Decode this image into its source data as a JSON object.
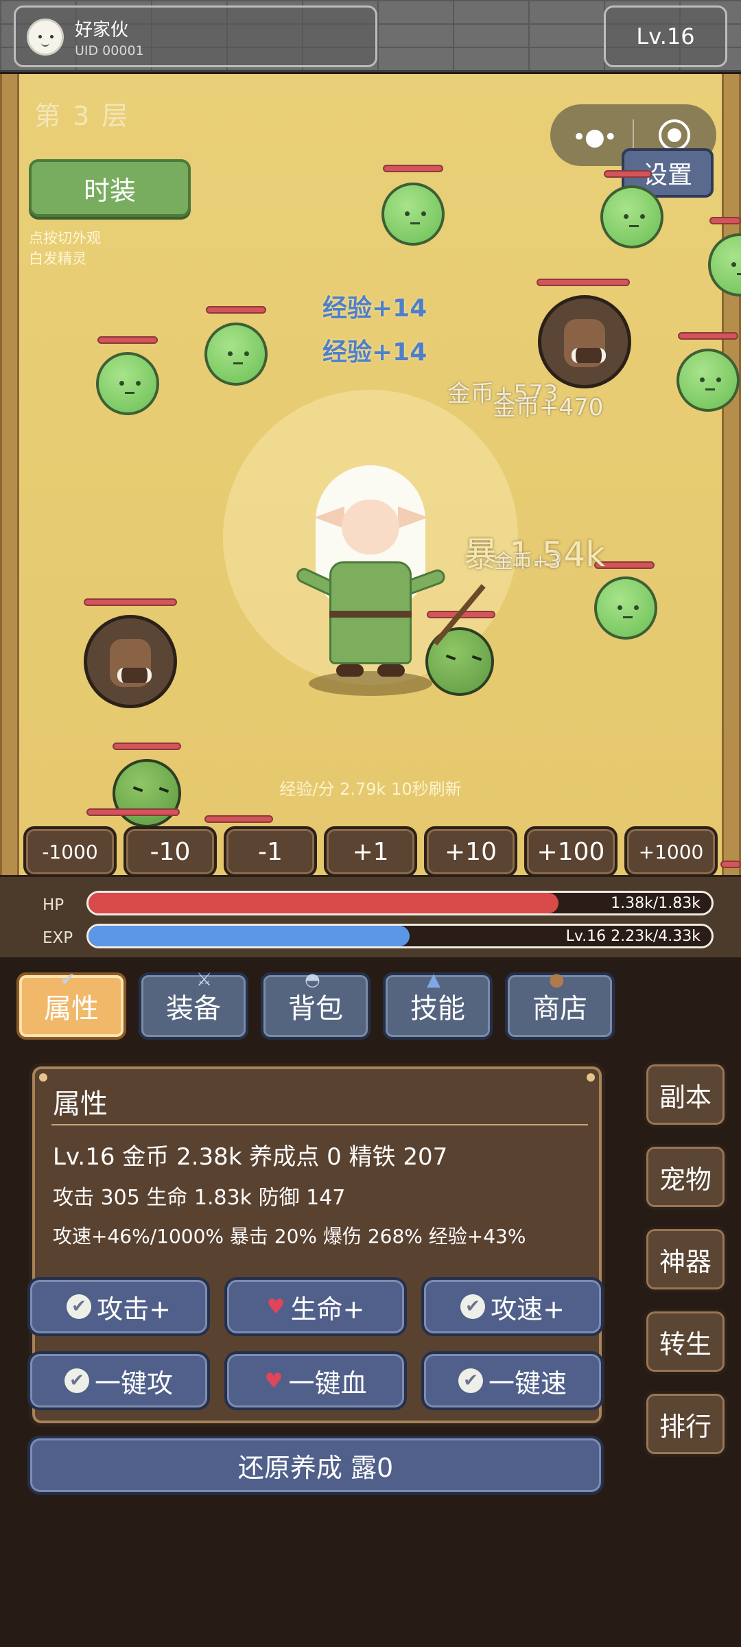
{
  "header": {
    "player_name": "好家伙",
    "uid": "UID 00001",
    "level": "Lv.16"
  },
  "field": {
    "floor": "第 3 层",
    "skin_button": "时装",
    "skin_hint_1": "点按切外观",
    "skin_hint_2": "白发精灵",
    "settings": "设置",
    "capsule_more": "•●•",
    "floats": {
      "exp_1": "经验+14",
      "exp_2": "经验+14",
      "gold_1": "金币+573",
      "gold_2": "金币+470",
      "crit": "暴 1.54k",
      "gold_3": "金币+3"
    },
    "rate_text": "经验/分 2.79k  10秒刷新",
    "adjust_buttons": [
      "-1000",
      "-10",
      "-1",
      "+1",
      "+10",
      "+100",
      "+1000"
    ]
  },
  "bars": {
    "hp_label": "HP",
    "hp_text": "1.38k/1.83k",
    "hp_fraction": 0.754,
    "hp_color": "#d94a4a",
    "exp_label": "EXP",
    "exp_text": "Lv.16  2.23k/4.33k",
    "exp_fraction": 0.515,
    "exp_color": "#5b97e6"
  },
  "tabs": [
    {
      "label": "属性",
      "icon": "check-icon"
    },
    {
      "label": "装备",
      "icon": "sword-icon"
    },
    {
      "label": "背包",
      "icon": "bag-icon"
    },
    {
      "label": "技能",
      "icon": "gem-icon"
    },
    {
      "label": "商店",
      "icon": "pot-icon"
    }
  ],
  "attributes": {
    "title": "属性",
    "line1": "Lv.16  金币 2.38k  养成点 0  精铁 207",
    "line2": "攻击 305  生命 1.83k  防御 147",
    "line3": "攻速+46%/1000%  暴击 20%  爆伤 268%  经验+43%"
  },
  "actions": {
    "attack_plus": "攻击+",
    "hp_plus": "生命+",
    "speed_plus": "攻速+",
    "one_attack": "一键攻",
    "one_hp": "一键血",
    "one_speed": "一键速",
    "reset": "还原养成 露0"
  },
  "side_menu": [
    "副本",
    "宠物",
    "神器",
    "转生",
    "排行"
  ]
}
